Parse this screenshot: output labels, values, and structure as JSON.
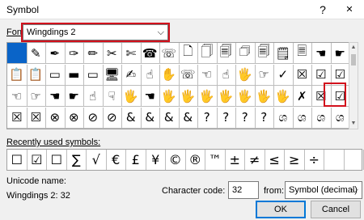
{
  "title": "Symbol",
  "help_glyph": "?",
  "close_glyph": "✕",
  "font_label": "Font:",
  "font_value": "Wingdings 2",
  "chevron": "⌵",
  "highlight_color": "#d2101c",
  "selected_color": "#0a64c8",
  "symbol_rows": [
    [
      "",
      "✎",
      "✒",
      "✑",
      "✏",
      "✂",
      "✄",
      "☎",
      "☏",
      "🗋",
      "🗍",
      "🗐",
      "🗇",
      "🗐",
      "🗒",
      "🗏",
      "☚",
      "☛"
    ],
    [
      "📋",
      "📋",
      "▭",
      "▬",
      "▭",
      "🖥",
      "✍",
      "☝",
      "✋",
      "☏",
      "☜",
      "☝",
      "🖐",
      "☞",
      "✓",
      "☒",
      "☑",
      "☑"
    ],
    [
      "☜",
      "☞",
      "☚",
      "☛",
      "☝",
      "☟",
      "🖐",
      "☚",
      "🖐",
      "🖐",
      "🖐",
      "🖐",
      "🖐",
      "🖐",
      "🖐",
      "✗",
      "☒",
      "☑"
    ],
    [
      "☒",
      "☒",
      "⊗",
      "⊗",
      "⊘",
      "⊘",
      "&",
      "&",
      "&",
      "&",
      "?",
      "?",
      "?",
      "?",
      "ශ",
      "ශ",
      "ශ",
      "ශ"
    ]
  ],
  "recent_label": "Recently used symbols:",
  "recent_symbols": [
    "☐",
    "☑",
    "☐",
    "∑",
    "√",
    "€",
    "£",
    "¥",
    "©",
    "®",
    "™",
    "±",
    "≠",
    "≤",
    "≥",
    "÷",
    "",
    ""
  ],
  "unicode_name_label": "Unicode name:",
  "unicode_name_value": "Wingdings 2: 32",
  "char_code_label": "Character code:",
  "char_code_value": "32",
  "from_label": "from:",
  "from_value": "Symbol (decimal)",
  "ok_label": "OK",
  "cancel_label": "Cancel"
}
